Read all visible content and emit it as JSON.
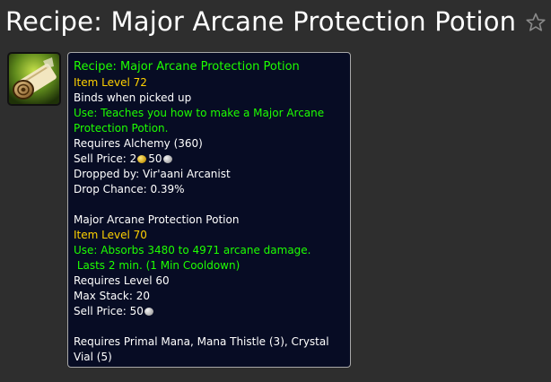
{
  "page": {
    "title": "Recipe: Major Arcane Protection Potion",
    "favorite_icon": "star-outline-icon"
  },
  "item_icon": "scroll-recipe-icon",
  "tooltip": {
    "name": "Recipe: Major Arcane Protection Potion",
    "item_level": "Item Level 72",
    "binds": "Binds when picked up",
    "use_line1": "Use: Teaches you how to make a Major Arcane",
    "use_line2": "Protection Potion.",
    "requires_skill": "Requires Alchemy (360)",
    "sell_label": "Sell Price: ",
    "sell_gold": "2",
    "sell_silver": "50",
    "dropped_by": "Dropped by: Vir'aani Arcanist",
    "drop_chance": "Drop Chance: 0.39%",
    "product": {
      "name": "Major Arcane Protection Potion",
      "item_level": "Item Level 70",
      "use_line1": "Use: Absorbs 3480 to 4971 arcane damage.",
      "use_line2": " Lasts 2 min. (1 Min Cooldown)",
      "requires_level": "Requires Level 60",
      "max_stack": "Max Stack: 20",
      "sell_label": "Sell Price: ",
      "sell_silver": "50"
    },
    "reagents_line1": "Requires Primal Mana, Mana Thistle (3), Crystal",
    "reagents_line2": "Vial (5)"
  },
  "colors": {
    "background": "#2e2e2e",
    "tooltip_bg": "#070c24",
    "tooltip_border": "#a8a8a8",
    "name_green": "#1eff00",
    "item_level_yellow": "#ffd100",
    "text_white": "#ffffff"
  }
}
